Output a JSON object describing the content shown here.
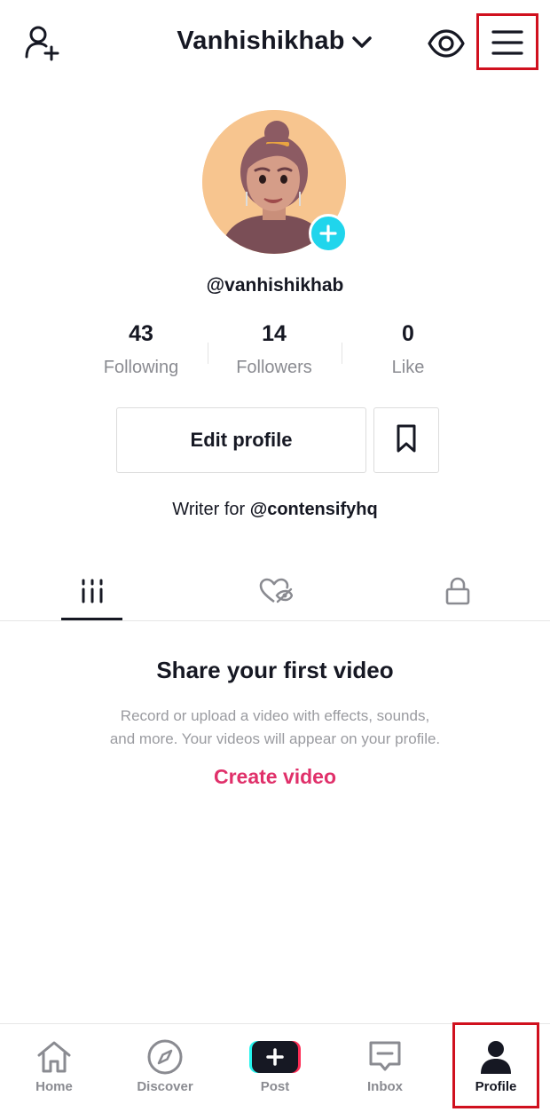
{
  "header": {
    "username_title": "Vanhishikhab",
    "icons": {
      "add_user": "add-user-icon",
      "dropdown": "chevron-down-icon",
      "profile_view": "eye-icon",
      "menu": "hamburger-menu-icon"
    }
  },
  "profile": {
    "avatar": "avatar",
    "avatar_add_icon": "plus-icon",
    "handle": "@vanhishikhab",
    "stats": [
      {
        "value": "43",
        "label": "Following"
      },
      {
        "value": "14",
        "label": "Followers"
      },
      {
        "value": "0",
        "label": "Like"
      }
    ],
    "edit_button": "Edit profile",
    "bookmark_icon": "bookmark-icon",
    "bio_prefix": "Writer for ",
    "bio_mention": "@contensifyhq"
  },
  "tabs": [
    {
      "icon": "videos-grid-icon",
      "active": true
    },
    {
      "icon": "liked-hidden-icon",
      "active": false
    },
    {
      "icon": "lock-icon",
      "active": false
    }
  ],
  "empty_state": {
    "title": "Share your first video",
    "description_line1": "Record or upload a video with effects, sounds,",
    "description_line2": "and more. Your videos will appear on your profile.",
    "action": "Create video"
  },
  "bottom_nav": [
    {
      "label": "Home",
      "icon": "home-icon"
    },
    {
      "label": "Discover",
      "icon": "compass-icon"
    },
    {
      "label": "Post",
      "icon": "post-plus-icon"
    },
    {
      "label": "Inbox",
      "icon": "inbox-icon"
    },
    {
      "label": "Profile",
      "icon": "profile-icon",
      "active": true
    }
  ],
  "colors": {
    "accent": "#e0306a",
    "highlight_box": "#d0101e",
    "avatar_plus": "#20d5ec",
    "text": "#161823",
    "muted": "#8a8b91"
  }
}
